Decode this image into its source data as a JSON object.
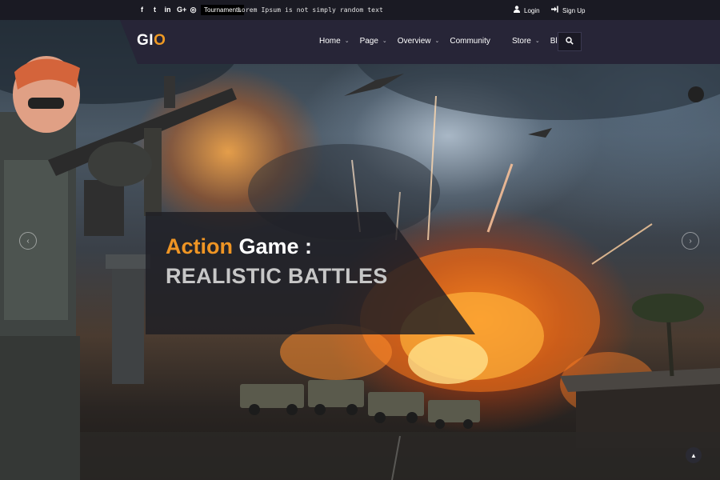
{
  "topbar": {
    "social": [
      {
        "glyph": "f",
        "icon": "facebook-icon"
      },
      {
        "glyph": "t",
        "icon": "twitter-icon"
      },
      {
        "glyph": "in",
        "icon": "linkedin-icon"
      },
      {
        "glyph": "G+",
        "icon": "google-plus-icon"
      },
      {
        "glyph": "◎",
        "icon": "instagram-icon"
      }
    ],
    "badge": "Tournaments",
    "ticker": "Lorem Ipsum is not simply random text",
    "login": "Login",
    "signup": "Sign Up"
  },
  "nav": {
    "logo_part1": "GI",
    "logo_part2": "O",
    "items": [
      {
        "label": "Home",
        "dropdown": true
      },
      {
        "label": "Page",
        "dropdown": true
      },
      {
        "label": "Overview",
        "dropdown": true
      },
      {
        "label": "Community",
        "dropdown": false
      },
      {
        "label": "Store",
        "dropdown": true
      },
      {
        "label": "Blog",
        "dropdown": true
      }
    ]
  },
  "hero": {
    "title_accent": "Action",
    "title_rest": " Game :",
    "subtitle": "REALISTIC BATTLES"
  },
  "colors": {
    "accent": "#f09a23",
    "nav_bg": "#272537",
    "topbar_bg": "#1a1a23"
  }
}
